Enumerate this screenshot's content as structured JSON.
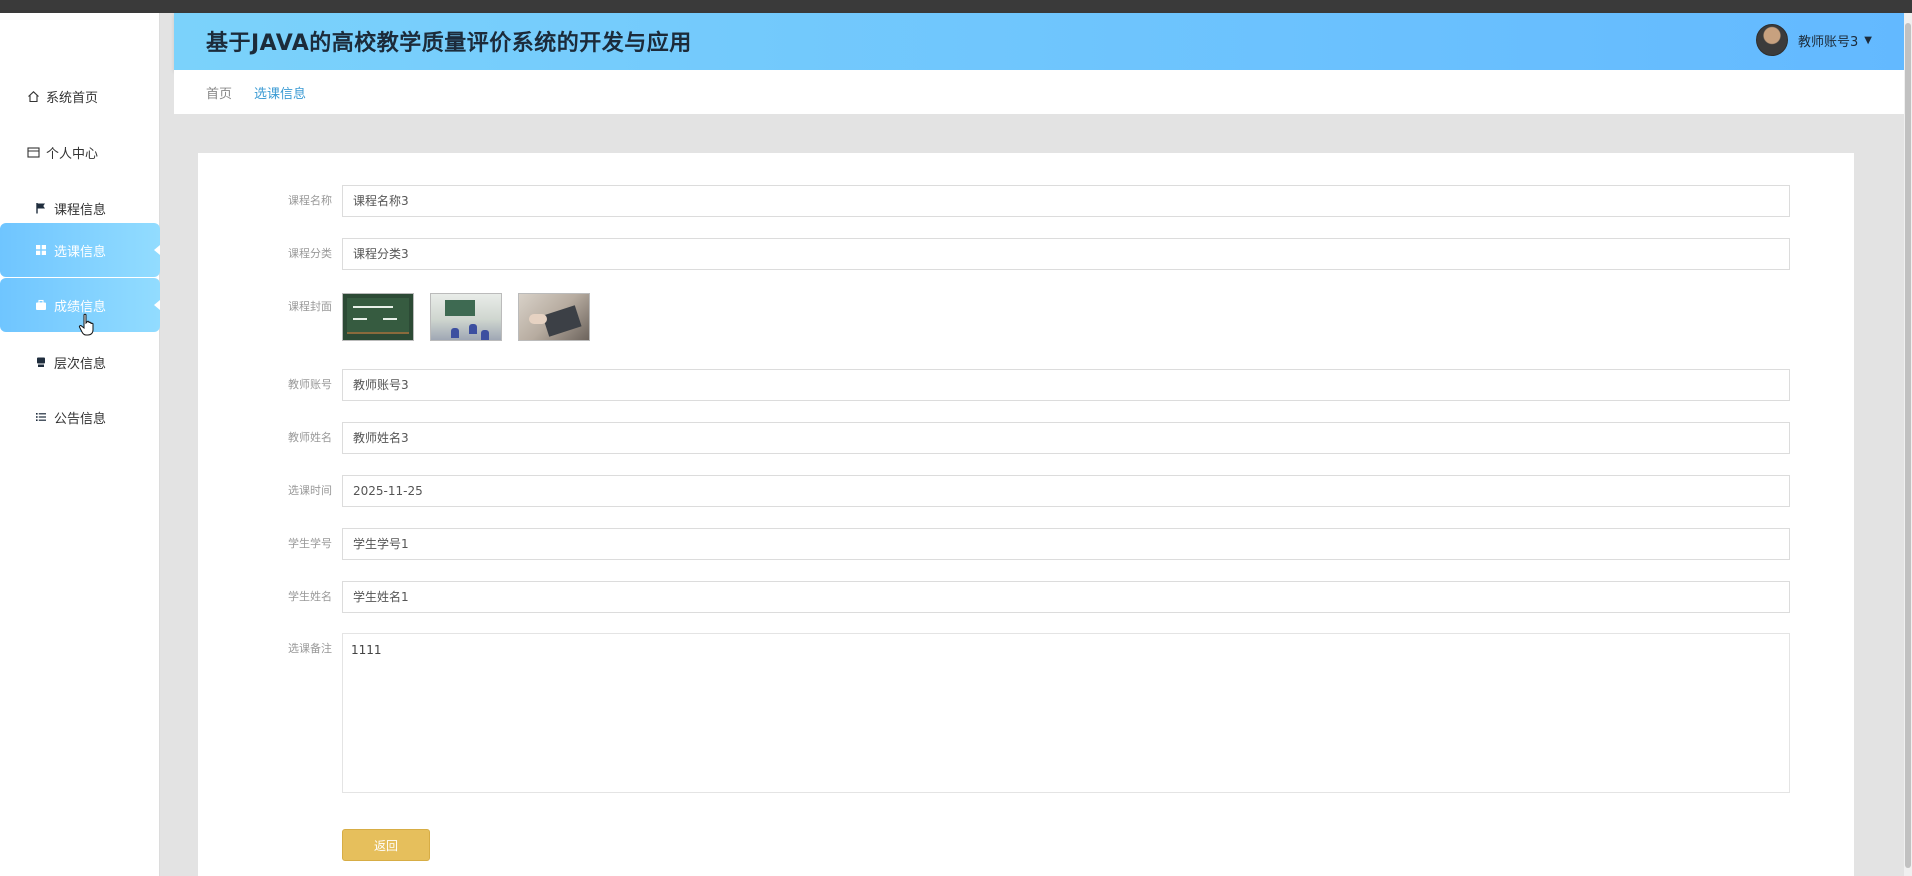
{
  "app": {
    "title": "基于JAVA的高校教学质量评价系统的开发与应用",
    "user_name": "教师账号3"
  },
  "sidebar": {
    "items": [
      {
        "label": "系统首页",
        "icon": "home-icon"
      },
      {
        "label": "个人中心",
        "icon": "id-card-icon"
      },
      {
        "label": "课程信息",
        "icon": "flag-icon"
      },
      {
        "label": "选课信息",
        "icon": "grid-icon",
        "active": true
      },
      {
        "label": "成绩信息",
        "icon": "briefcase-icon",
        "hover": true
      },
      {
        "label": "层次信息",
        "icon": "stack-icon"
      },
      {
        "label": "公告信息",
        "icon": "list-icon"
      }
    ]
  },
  "breadcrumb": {
    "home": "首页",
    "current": "选课信息"
  },
  "form": {
    "course_name": {
      "label": "课程名称",
      "value": "课程名称3"
    },
    "course_category": {
      "label": "课程分类",
      "value": "课程分类3"
    },
    "course_cover": {
      "label": "课程封面"
    },
    "teacher_account": {
      "label": "教师账号",
      "value": "教师账号3"
    },
    "teacher_name": {
      "label": "教师姓名",
      "value": "教师姓名3"
    },
    "selection_time": {
      "label": "选课时间",
      "value": "2025-11-25"
    },
    "student_id": {
      "label": "学生学号",
      "value": "学生学号1"
    },
    "student_name": {
      "label": "学生姓名",
      "value": "学生姓名1"
    },
    "selection_remark": {
      "label": "选课备注",
      "value": "1111"
    },
    "back_button": "返回"
  },
  "colors": {
    "header_start": "#7bd2fb",
    "header_end": "#63b9ff",
    "nav_active": "#6fc5ff",
    "crumb_active": "#3b9bd4",
    "back_button": "#e6bf5c"
  }
}
